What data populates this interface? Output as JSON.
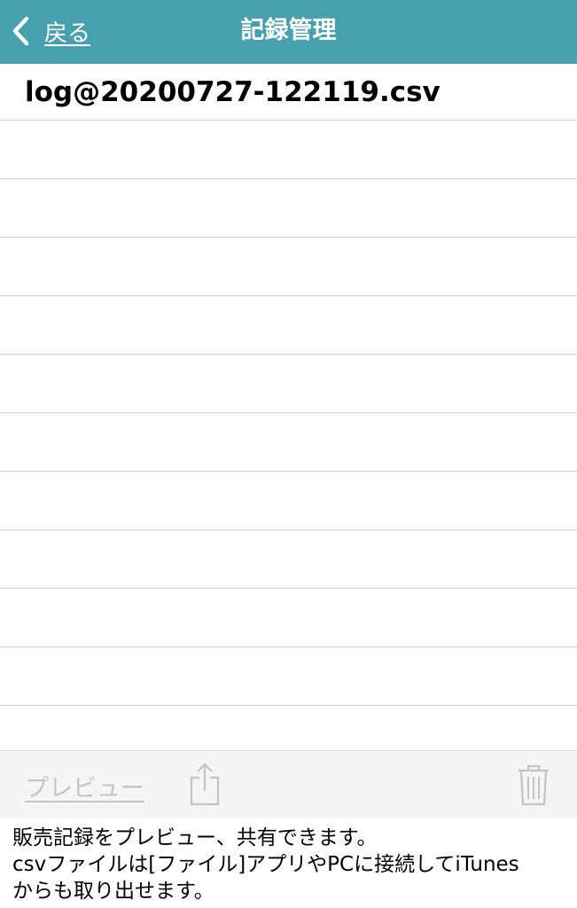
{
  "navbar": {
    "back_label": "戻る",
    "back_icon": "chevron-left-icon",
    "title": "記録管理",
    "background_color": "#46a0ad"
  },
  "file_list": {
    "items": [
      {
        "label": "log@20200727-122119.csv"
      },
      {
        "label": ""
      },
      {
        "label": ""
      },
      {
        "label": ""
      },
      {
        "label": ""
      },
      {
        "label": ""
      },
      {
        "label": ""
      },
      {
        "label": ""
      },
      {
        "label": ""
      },
      {
        "label": ""
      },
      {
        "label": ""
      },
      {
        "label": ""
      }
    ]
  },
  "toolbar": {
    "preview_label": "プレビュー",
    "share_icon": "share-icon",
    "trash_icon": "trash-icon",
    "disabled_color": "#c4c4c4"
  },
  "description": {
    "line1": "販売記録をプレビュー、共有できます。",
    "line2": "csvファイルは[ファイル]アプリやPCに接続してiTunes",
    "line3": "からも取り出せます。"
  }
}
